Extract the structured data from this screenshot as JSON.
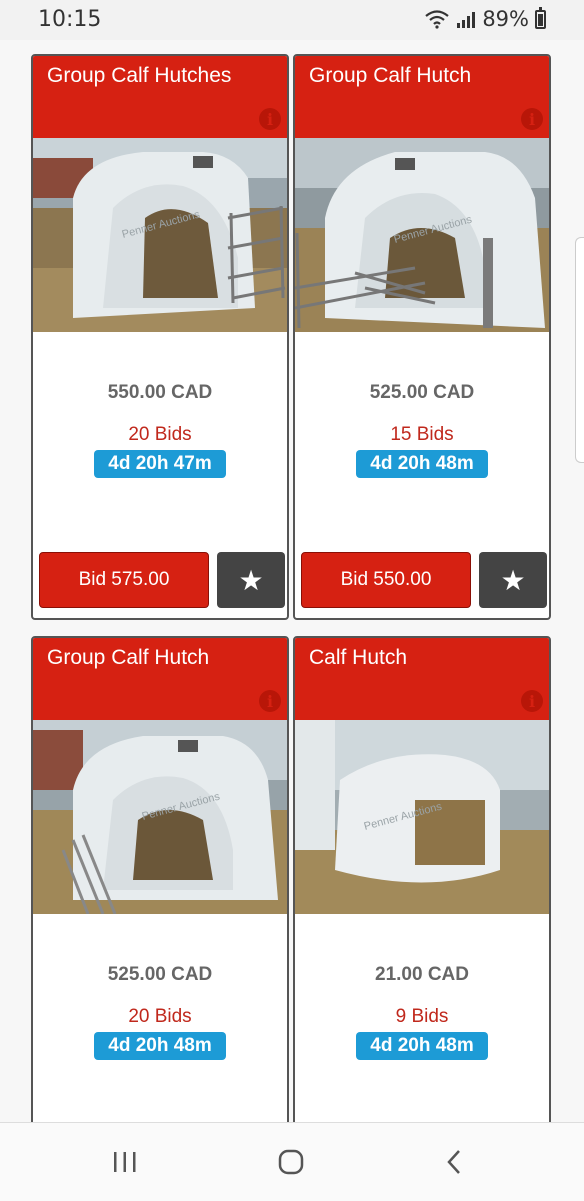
{
  "status_bar": {
    "time": "10:15",
    "battery": "89%"
  },
  "listings": [
    {
      "title": "Group Calf Hutches",
      "price": "550.00 CAD",
      "bids": "20 Bids",
      "time_left": "4d 20h 47m",
      "bid_label": "Bid 575.00"
    },
    {
      "title": "Group Calf Hutch",
      "price": "525.00 CAD",
      "bids": "15 Bids",
      "time_left": "4d 20h 48m",
      "bid_label": "Bid 550.00"
    },
    {
      "title": "Group Calf Hutch",
      "price": "525.00 CAD",
      "bids": "20 Bids",
      "time_left": "4d 20h 48m"
    },
    {
      "title": "Calf Hutch",
      "price": "21.00 CAD",
      "bids": "9 Bids",
      "time_left": "4d 20h 48m"
    }
  ],
  "watermark": "Penner Auctions",
  "icons": {
    "info": "info-icon",
    "favorite": "star-icon",
    "recents": "recents-icon",
    "home": "home-icon",
    "back": "back-icon"
  },
  "colors": {
    "header_red": "#d62112",
    "timer_blue": "#1d9bd6",
    "bids_red": "#c0281c"
  }
}
